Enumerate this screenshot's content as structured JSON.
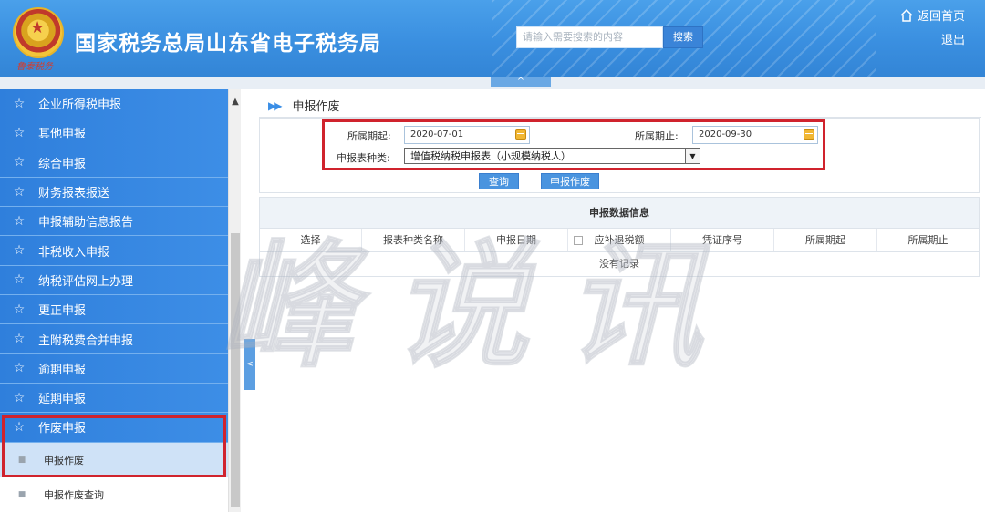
{
  "header": {
    "site_title": "国家税务总局山东省电子税务局",
    "emblem_signature": "鲁泰税务",
    "search": {
      "placeholder": "请输入需要搜索的内容",
      "button_label": "搜索"
    },
    "home_link": "返回首页",
    "logout_link": "退出",
    "collapse_label": "^"
  },
  "sidebar": {
    "items": [
      {
        "label": "企业所得税申报"
      },
      {
        "label": "其他申报"
      },
      {
        "label": "综合申报"
      },
      {
        "label": "财务报表报送"
      },
      {
        "label": "申报辅助信息报告"
      },
      {
        "label": "非税收入申报"
      },
      {
        "label": "纳税评估网上办理"
      },
      {
        "label": "更正申报"
      },
      {
        "label": "主附税费合并申报"
      },
      {
        "label": "逾期申报"
      },
      {
        "label": "延期申报"
      },
      {
        "label": "作废申报"
      }
    ],
    "sub_items": [
      {
        "label": "申报作废",
        "active": true
      },
      {
        "label": "申报作废查询",
        "active": false
      }
    ],
    "toggle_label": "<"
  },
  "main": {
    "breadcrumb": "申报作废",
    "form": {
      "start_label": "所属期起:",
      "start_value": "2020-07-01",
      "end_label": "所属期止:",
      "end_value": "2020-09-30",
      "type_label": "申报表种类:",
      "type_value": "增值税纳税申报表（小规模纳税人）",
      "query_button": "查询",
      "void_button": "申报作废"
    },
    "table": {
      "title": "申报数据信息",
      "columns": [
        "选择",
        "报表种类名称",
        "申报日期",
        "应补退税额",
        "凭证序号",
        "所属期起",
        "所属期止"
      ],
      "empty_text": "没有记录"
    }
  },
  "watermark": "峰说讯",
  "colors": {
    "header_blue": "#3a8fe0",
    "menu_blue": "#3d8ee6",
    "highlight_red": "#d0232d"
  }
}
